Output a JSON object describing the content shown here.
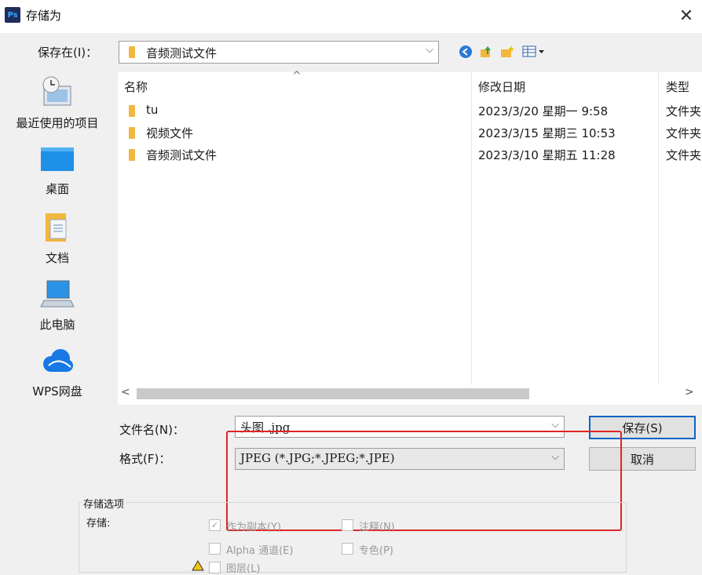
{
  "window": {
    "app_icon": "Ps",
    "title": "存储为",
    "close_glyph": "✕"
  },
  "save_in": {
    "label": "保存在(I)：",
    "value": "音频测试文件",
    "arrow": "⌵"
  },
  "toolbar": {
    "back": "◀",
    "up": "⬆",
    "new_folder": "✚",
    "view": "▦▾"
  },
  "places": [
    {
      "label": "最近使用的项目",
      "icon": "recent-icon"
    },
    {
      "label": "桌面",
      "icon": "desktop-icon"
    },
    {
      "label": "文档",
      "icon": "documents-icon"
    },
    {
      "label": "此电脑",
      "icon": "computer-icon"
    },
    {
      "label": "WPS网盘",
      "icon": "cloud-icon"
    }
  ],
  "file_list": {
    "sort_glyph": "^",
    "columns": {
      "name": "名称",
      "date": "修改日期",
      "type": "类型"
    },
    "rows": [
      {
        "name": "tu",
        "date": "2023/3/20 星期一 9:58",
        "type": "文件夹"
      },
      {
        "name": "视频文件",
        "date": "2023/3/15 星期三 10:53",
        "type": "文件夹"
      },
      {
        "name": "音频测试文件",
        "date": "2023/3/10 星期五 11:28",
        "type": "文件夹"
      }
    ]
  },
  "scroll": {
    "left": "<",
    "right": ">"
  },
  "filename": {
    "label": "文件名(N)：",
    "value": "头图 .jpg",
    "arrow": "⌵"
  },
  "format": {
    "label": "格式(F)：",
    "value": "JPEG (*.JPG;*.JPEG;*.JPE)",
    "arrow": "⌵"
  },
  "buttons": {
    "save": "保存(S)",
    "cancel": "取消"
  },
  "options": {
    "group_title": "存储选项",
    "save_label": "存储:",
    "as_copy": "作为副本(Y)",
    "notes": "注释(N)",
    "alpha": "Alpha 通道(E)",
    "spot": "专色(P)",
    "layers": "图层(L)"
  },
  "colors": {
    "highlight": "#e02424",
    "folder": "#f2b73d",
    "accent": "#0a64c8"
  }
}
